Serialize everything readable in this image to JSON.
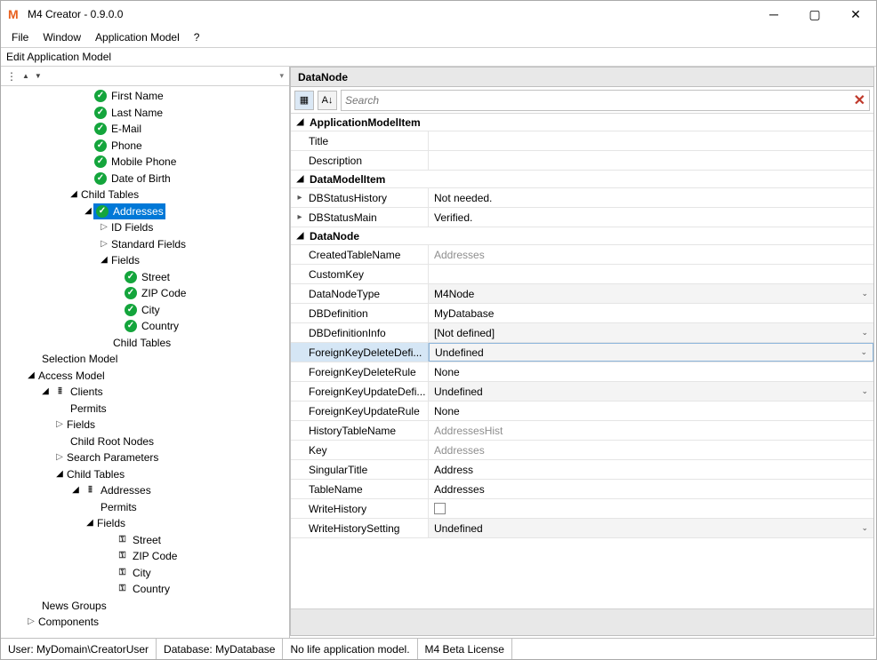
{
  "window": {
    "title": "M4 Creator - 0.9.0.0"
  },
  "menu": {
    "file": "File",
    "window": "Window",
    "appModel": "Application Model",
    "help": "?"
  },
  "subheader": "Edit Application Model",
  "tree": {
    "FirstName": "First Name",
    "LastName": "Last Name",
    "EMail": "E-Mail",
    "Phone": "Phone",
    "MobilePhone": "Mobile Phone",
    "DateOfBirth": "Date of Birth",
    "ChildTables": "Child Tables",
    "Addresses": "Addresses",
    "IDFields": "ID Fields",
    "StandardFields": "Standard Fields",
    "Fields": "Fields",
    "Street": "Street",
    "ZIPCode": "ZIP Code",
    "City": "City",
    "Country": "Country",
    "ChildTables2": "Child Tables",
    "SelectionModel": "Selection Model",
    "AccessModel": "Access Model",
    "Clients": "Clients",
    "Permits": "Permits",
    "Fields2": "Fields",
    "ChildRootNodes": "Child Root Nodes",
    "SearchParameters": "Search Parameters",
    "ChildTables3": "Child Tables",
    "Addresses2": "Addresses",
    "Permits2": "Permits",
    "Fields3": "Fields",
    "Street2": "Street",
    "ZIPCode2": "ZIP Code",
    "City2": "City",
    "Country2": "Country",
    "NewsGroups": "News Groups",
    "Components": "Components"
  },
  "panel": {
    "title": "DataNode",
    "searchPlaceholder": "Search",
    "cats": {
      "ApplicationModelItem": "ApplicationModelItem",
      "DataModelItem": "DataModelItem",
      "DataNode": "DataNode"
    },
    "rows": {
      "Title": {
        "name": "Title",
        "value": ""
      },
      "Description": {
        "name": "Description",
        "value": ""
      },
      "DBStatusHistory": {
        "name": "DBStatusHistory",
        "value": "Not needed."
      },
      "DBStatusMain": {
        "name": "DBStatusMain",
        "value": "Verified."
      },
      "CreatedTableName": {
        "name": "CreatedTableName",
        "value": "Addresses"
      },
      "CustomKey": {
        "name": "CustomKey",
        "value": ""
      },
      "DataNodeType": {
        "name": "DataNodeType",
        "value": "M4Node"
      },
      "DBDefinition": {
        "name": "DBDefinition",
        "value": "MyDatabase"
      },
      "DBDefinitionInfo": {
        "name": "DBDefinitionInfo",
        "value": "[Not defined]"
      },
      "ForeignKeyDeleteDefi": {
        "name": "ForeignKeyDeleteDefi...",
        "value": "Undefined"
      },
      "ForeignKeyDeleteRule": {
        "name": "ForeignKeyDeleteRule",
        "value": "None"
      },
      "ForeignKeyUpdateDefi": {
        "name": "ForeignKeyUpdateDefi...",
        "value": "Undefined"
      },
      "ForeignKeyUpdateRule": {
        "name": "ForeignKeyUpdateRule",
        "value": "None"
      },
      "HistoryTableName": {
        "name": "HistoryTableName",
        "value": "AddressesHist"
      },
      "Key": {
        "name": "Key",
        "value": "Addresses"
      },
      "SingularTitle": {
        "name": "SingularTitle",
        "value": "Address"
      },
      "TableName": {
        "name": "TableName",
        "value": "Addresses"
      },
      "WriteHistory": {
        "name": "WriteHistory"
      },
      "WriteHistorySetting": {
        "name": "WriteHistorySetting",
        "value": "Undefined"
      }
    }
  },
  "status": {
    "user": "User: MyDomain\\CreatorUser",
    "db": "Database: MyDatabase",
    "life": "No life application model.",
    "lic": "M4 Beta License"
  }
}
